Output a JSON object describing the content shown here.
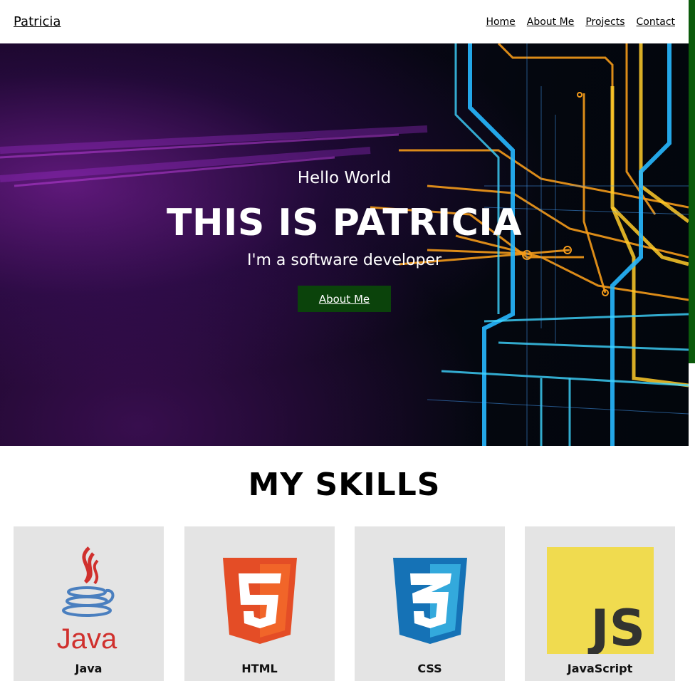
{
  "header": {
    "brand": "Patricia",
    "nav": [
      "Home",
      "About Me",
      "Projects",
      "Contact"
    ]
  },
  "hero": {
    "greeting": "Hello World",
    "title": "THIS IS PATRICIA",
    "subtitle": "I'm a software developer",
    "button_label": "About Me"
  },
  "skills": {
    "title": "MY SKILLS",
    "items": [
      {
        "label": "Java",
        "icon": "java-icon"
      },
      {
        "label": "HTML",
        "icon": "html5-icon"
      },
      {
        "label": "CSS",
        "icon": "css3-icon"
      },
      {
        "label": "JavaScript",
        "icon": "javascript-icon"
      }
    ],
    "logo_text": {
      "java": "Java",
      "js": "JS"
    }
  },
  "colors": {
    "accent_green": "#0b430b",
    "card_bg": "#e4e4e4",
    "html_orange": "#e44d26",
    "css_blue": "#1572b6",
    "js_yellow": "#f0db4f"
  }
}
